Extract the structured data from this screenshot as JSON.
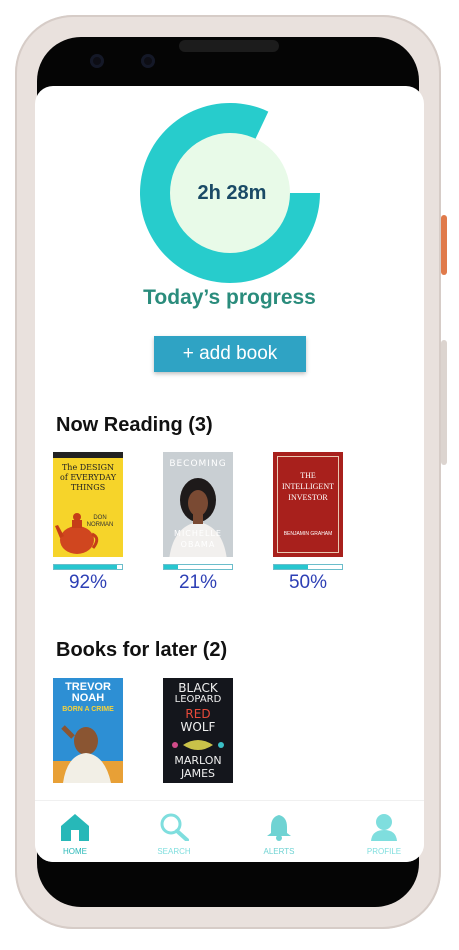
{
  "progress": {
    "time": "2h 28m",
    "title": "Today’s progress",
    "ring_fraction": 0.82,
    "ring_color": "#27cccc",
    "center_color": "#e8fae8"
  },
  "add_book_label": "+ add book",
  "now_reading": {
    "title": "Now Reading (3)",
    "books": [
      {
        "cover_line1": "The DESIGN",
        "cover_line2": "of EVERYDAY",
        "cover_line3": "THINGS",
        "author_first": "DON",
        "author_last": "NORMAN",
        "progress": 0.92,
        "percent_label": "92%"
      },
      {
        "cover_top": "BECOMING",
        "author_first": "MICHELLE",
        "author_last": "OBAMA",
        "progress": 0.21,
        "percent_label": "21%"
      },
      {
        "cover_line1": "THE",
        "cover_line2": "INTELLIGENT",
        "cover_line3": "INVESTOR",
        "author": "BENJAMIN GRAHAM",
        "progress": 0.5,
        "percent_label": "50%"
      }
    ]
  },
  "later": {
    "title": "Books for later (2)",
    "books": [
      {
        "author_first": "TREVOR",
        "author_last": "NOAH",
        "cover_title": "BORN A CRIME"
      },
      {
        "title_words": [
          "BLACK",
          "LEOPARD",
          "RED",
          "WOLF"
        ],
        "author_first": "MARLON",
        "author_last": "JAMES"
      }
    ]
  },
  "nav": {
    "items": [
      {
        "label": "HOME",
        "icon": "home-icon",
        "active": true
      },
      {
        "label": "SEARCH",
        "icon": "search-icon",
        "active": false
      },
      {
        "label": "ALERTS",
        "icon": "bell-icon",
        "active": false
      },
      {
        "label": "PROFILE",
        "icon": "user-icon",
        "active": false
      }
    ],
    "active_color": "#27b8b8",
    "inactive_color": "#7fdede"
  }
}
